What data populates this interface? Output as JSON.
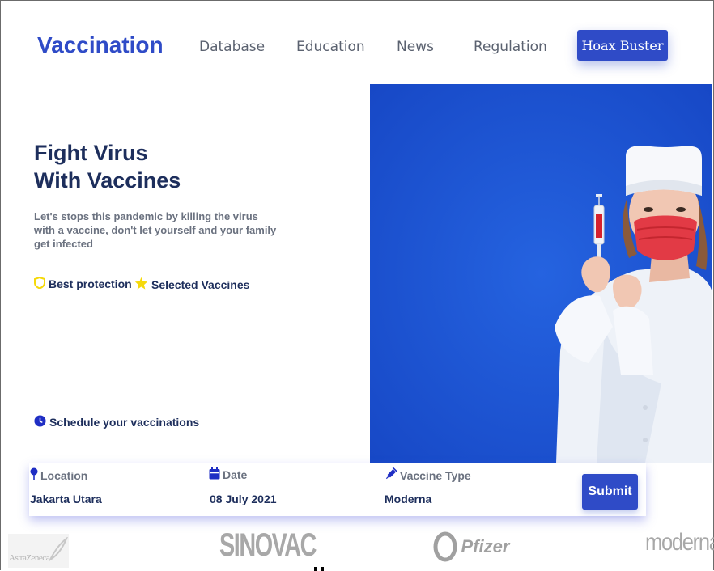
{
  "brand": "Vaccination",
  "nav": {
    "items": [
      "Database",
      "Education",
      "News",
      "Regulation"
    ],
    "cta": "Hoax Buster"
  },
  "hero": {
    "title_line1": "Fight Virus",
    "title_line2": "With Vaccines",
    "subtitle": "Let's stops this pandemic by killing the virus with a vaccine, don't let yourself and your family get infected",
    "features": [
      "Best protection",
      "Selected Vaccines"
    ],
    "schedule": "Schedule your vaccinations"
  },
  "form": {
    "location_label": "Location",
    "location_value": "Jakarta Utara",
    "date_label": "Date",
    "date_value": "08 July 2021",
    "vaccine_label": "Vaccine Type",
    "vaccine_value": "Moderna",
    "submit": "Submit"
  },
  "brands": [
    "AstraZeneca",
    "SINOVAC",
    "Pfizer",
    "moderna"
  ],
  "colors": {
    "accent": "#2f4bc7",
    "heading": "#1d2e5c",
    "photo_bg": "#1c55d6",
    "yellow": "#f5d90a"
  },
  "icons": [
    "shield-icon",
    "star-icon",
    "clock-icon",
    "location-pin-icon",
    "calendar-icon",
    "syringe-icon"
  ]
}
